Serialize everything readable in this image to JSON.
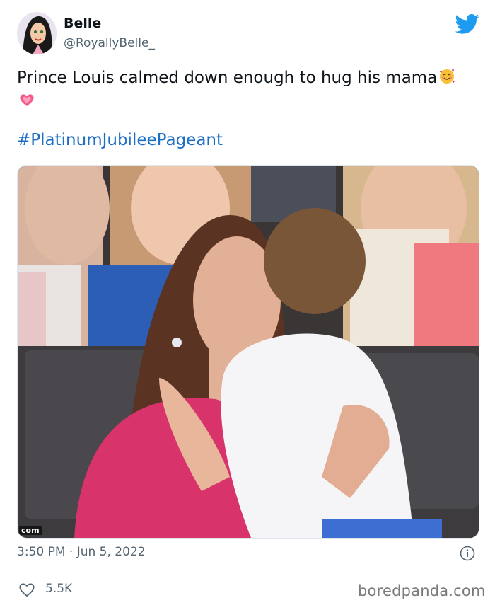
{
  "tweet": {
    "author_name": "Belle",
    "author_handle": "@RoyallyBelle_",
    "text": "Prince Louis calmed down enough to hug his mama",
    "emojis": [
      "smiling-face-with-hearts",
      "growing-heart"
    ],
    "hashtag": "#PlatinumJubileePageant",
    "image_watermark": "com",
    "timestamp": "3:50 PM · Jun 5, 2022",
    "like_count": "5.5K"
  },
  "footer": {
    "brand": "boredpanda.com"
  },
  "colors": {
    "twitter_blue": "#1d9bf0",
    "hashtag_blue": "#1d6fc5",
    "secondary_text": "#536471",
    "divider": "#e1e8ed"
  },
  "icons": [
    "twitter-bird-icon",
    "info-icon",
    "heart-icon"
  ]
}
